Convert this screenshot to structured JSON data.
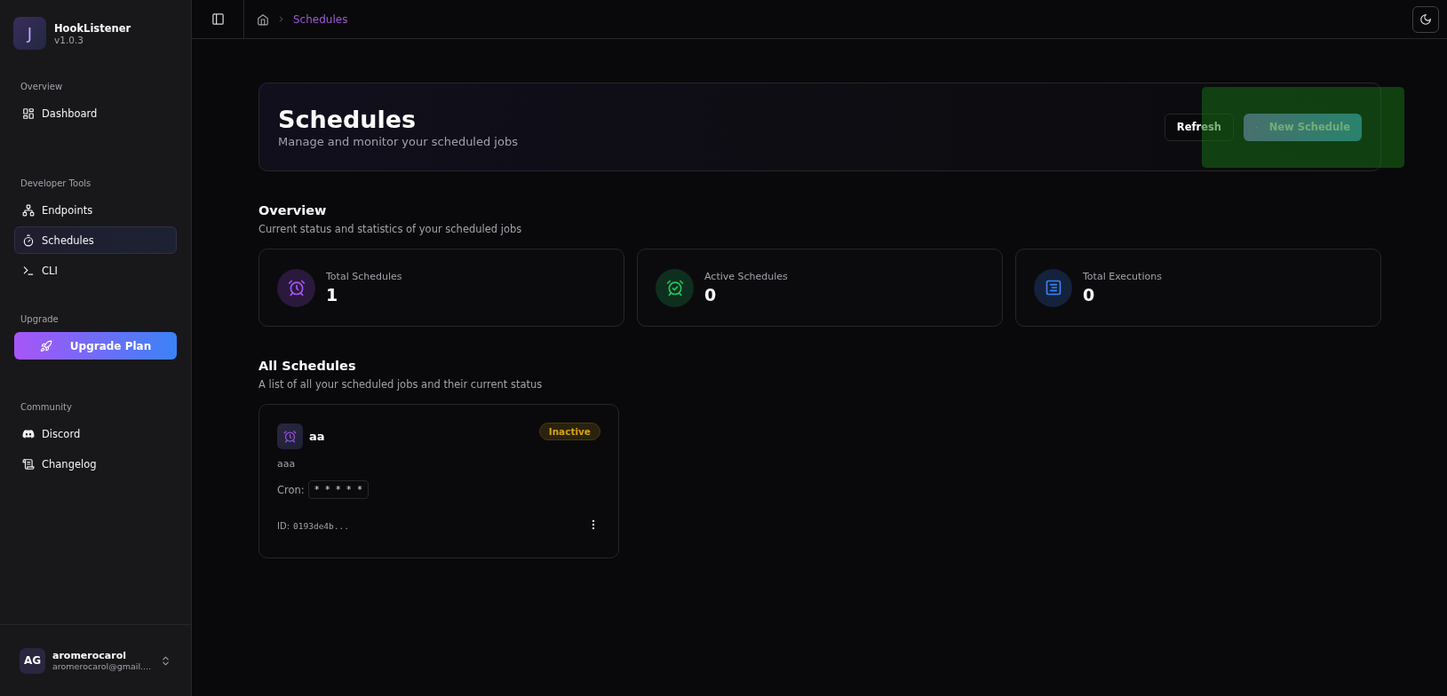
{
  "app": {
    "name": "HookListener",
    "version": "v1.0.3",
    "logo_letter": "J"
  },
  "sidebar": {
    "sections": [
      {
        "title": "Overview",
        "items": [
          {
            "label": "Dashboard",
            "selected": false
          }
        ]
      },
      {
        "title": "Developer Tools",
        "items": [
          {
            "label": "Endpoints",
            "selected": false
          },
          {
            "label": "Schedules",
            "selected": true
          },
          {
            "label": "CLI",
            "selected": false
          }
        ]
      },
      {
        "title": "Upgrade",
        "button": "Upgrade Plan"
      },
      {
        "title": "Community",
        "items": [
          {
            "label": "Discord",
            "selected": false
          },
          {
            "label": "Changelog",
            "selected": false
          }
        ]
      }
    ]
  },
  "user": {
    "initials": "AG",
    "name": "aromerocarol",
    "email": "aromerocarol@gmail...."
  },
  "breadcrumb": {
    "current": "Schedules"
  },
  "page": {
    "title": "Schedules",
    "subtitle": "Manage and monitor your scheduled jobs",
    "buttons": {
      "refresh": "Refresh",
      "new": "New Schedule"
    }
  },
  "overview": {
    "title": "Overview",
    "subtitle": "Current status and statistics of your scheduled jobs",
    "stats": [
      {
        "label": "Total Schedules",
        "value": "1",
        "color": "#a855f7"
      },
      {
        "label": "Active Schedules",
        "value": "0",
        "color": "#22c55e"
      },
      {
        "label": "Total Executions",
        "value": "0",
        "color": "#3b82f6"
      }
    ]
  },
  "schedules": {
    "title": "All Schedules",
    "subtitle": "A list of all your scheduled jobs and their current status",
    "items": [
      {
        "name": "aa",
        "description": "aaa",
        "status": "Inactive",
        "active": false,
        "cron_label": "Cron:",
        "cron": "* * * * *",
        "id_label": "ID:",
        "id": "0193de4b..."
      }
    ]
  }
}
